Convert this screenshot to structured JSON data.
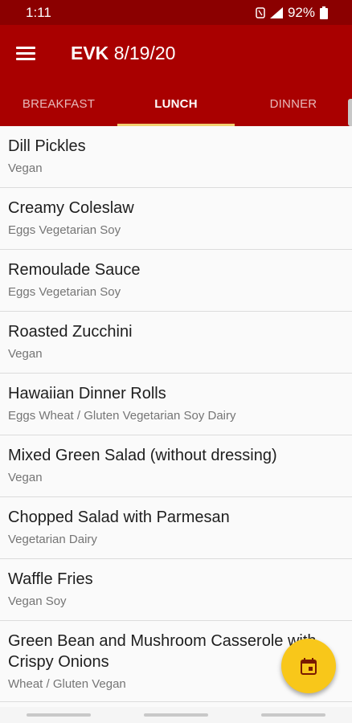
{
  "status": {
    "time": "1:11",
    "battery": "92%"
  },
  "appbar": {
    "location": "EVK",
    "date": "8/19/20"
  },
  "tabs": [
    {
      "label": "BREAKFAST",
      "active": false
    },
    {
      "label": "LUNCH",
      "active": true
    },
    {
      "label": "DINNER",
      "active": false
    }
  ],
  "items": [
    {
      "name": "Dill Pickles",
      "tags": "Vegan"
    },
    {
      "name": "Creamy Coleslaw",
      "tags": "Eggs Vegetarian Soy"
    },
    {
      "name": "Remoulade Sauce",
      "tags": "Eggs Vegetarian Soy"
    },
    {
      "name": "Roasted Zucchini",
      "tags": "Vegan"
    },
    {
      "name": "Hawaiian Dinner Rolls",
      "tags": "Eggs Wheat / Gluten Vegetarian Soy Dairy"
    },
    {
      "name": "Mixed Green Salad (without dressing)",
      "tags": "Vegan"
    },
    {
      "name": "Chopped Salad with Parmesan",
      "tags": "Vegetarian Dairy"
    },
    {
      "name": "Waffle Fries",
      "tags": "Vegan Soy"
    },
    {
      "name": "Green Bean and Mushroom Casserole with Crispy Onions",
      "tags": "Wheat / Gluten Vegan"
    }
  ],
  "colors": {
    "appbar": "#a90000",
    "statusbar": "#8b0000",
    "tab_indicator": "#f2d070",
    "fab": "#f8c71a"
  },
  "icons": {
    "menu": "menu-icon",
    "fab": "calendar-icon"
  }
}
